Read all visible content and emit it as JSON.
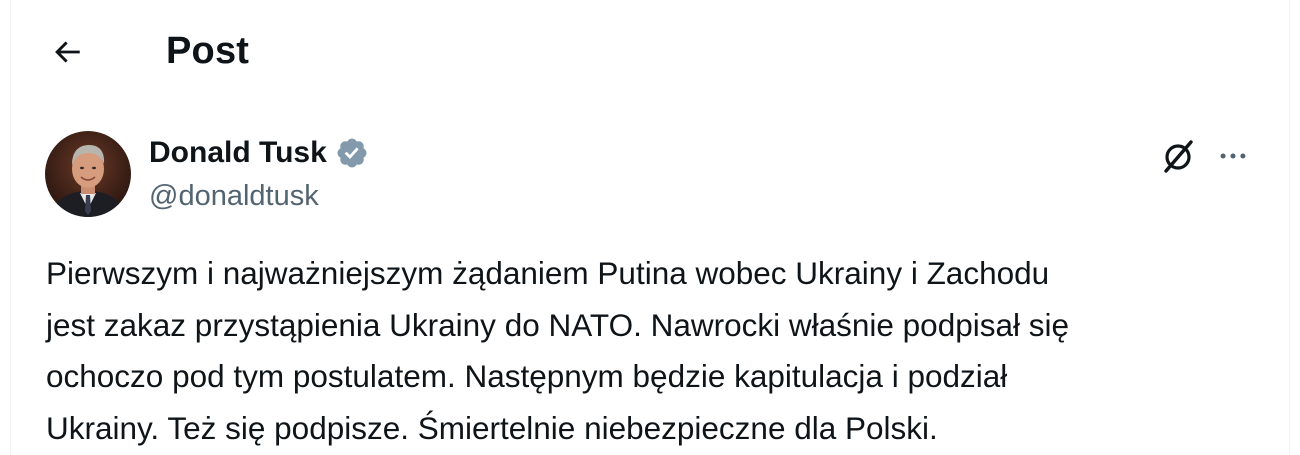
{
  "header": {
    "title": "Post",
    "back_icon": "arrow-left-icon"
  },
  "post": {
    "author": {
      "name": "Donald Tusk",
      "handle": "@donaldtusk",
      "verified": true,
      "badge_color": "#829aab"
    },
    "actions": {
      "grok_icon": "grok-icon",
      "more_icon": "more-horizontal-icon"
    },
    "text_lines": [
      "Pierwszym i najważniejszym żądaniem Putina wobec Ukrainy i Zachodu",
      "jest zakaz przystąpienia Ukrainy do NATO. Nawrocki właśnie podpisał się",
      "ochoczo pod tym postulatem. Następnym będzie kapitulacja i podział",
      "Ukrainy. Też się podpisze. Śmiertelnie niebezpieczne dla Polski."
    ]
  },
  "colors": {
    "text": "#0f1419",
    "secondary_text": "#536471",
    "border": "#eff3f4"
  }
}
